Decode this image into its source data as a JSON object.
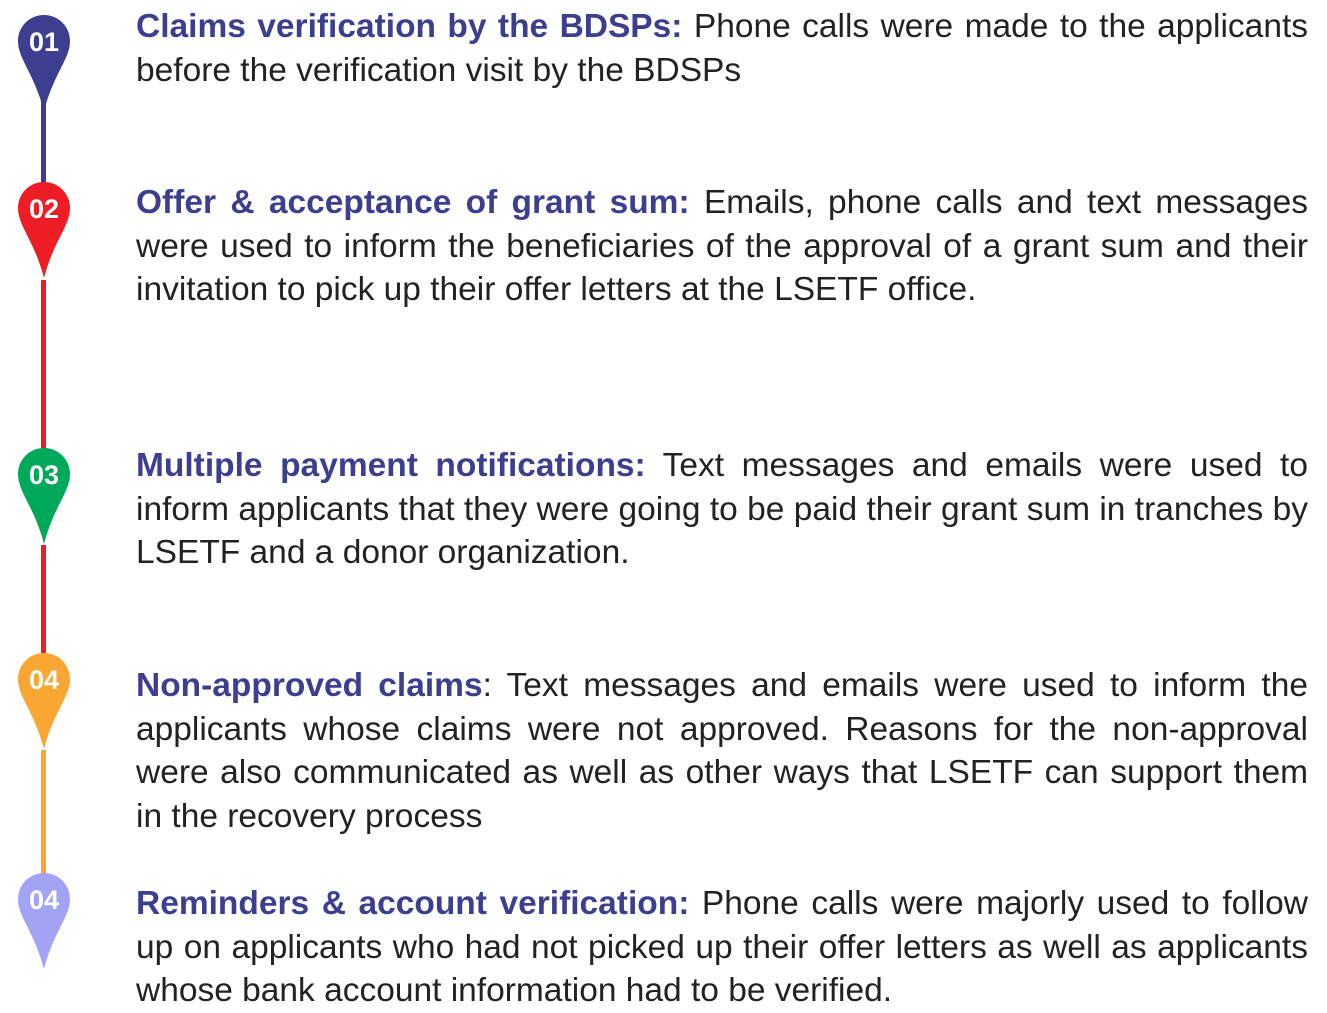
{
  "steps": [
    {
      "number": "01",
      "color": "#3d3e8f",
      "title": "Claims verification by the BDSPs:",
      "separator": "",
      "text": " Phone calls were made to the applicants before the verification visit by the BDSPs"
    },
    {
      "number": "02",
      "color": "#ee1c24",
      "title": "Offer & acceptance of grant sum:",
      "separator": "",
      "text": " Emails, phone calls and text messages were used to inform the beneficiaries of the approval of a grant sum and their invitation to pick up their offer letters at the LSETF office."
    },
    {
      "number": "03",
      "color": "#00a859",
      "title": "Multiple payment notifications:",
      "separator": "",
      "text": " Text messages and emails were used to inform applicants that they were going to be paid their grant sum in tranches by LSETF and a donor organization."
    },
    {
      "number": "04",
      "color": "#faa633",
      "title": "Non-approved claims",
      "separator": ":",
      "text": " Text messages and emails were used to inform the applicants whose claims were not approved. Reasons for the non-approval were also communicated as well as other ways that LSETF can support them in the recovery process"
    },
    {
      "number": "04",
      "color": "#a3a3f5",
      "title": "Reminders & account verification:",
      "separator": "",
      "text": " Phone calls were majorly used to follow up on applicants who had not picked up their offer letters as well as applicants whose bank account information had to be verified."
    }
  ],
  "connector_colors": [
    "#3d3e8f",
    "#ee1c24",
    "#ee1c24",
    "#faa633"
  ]
}
